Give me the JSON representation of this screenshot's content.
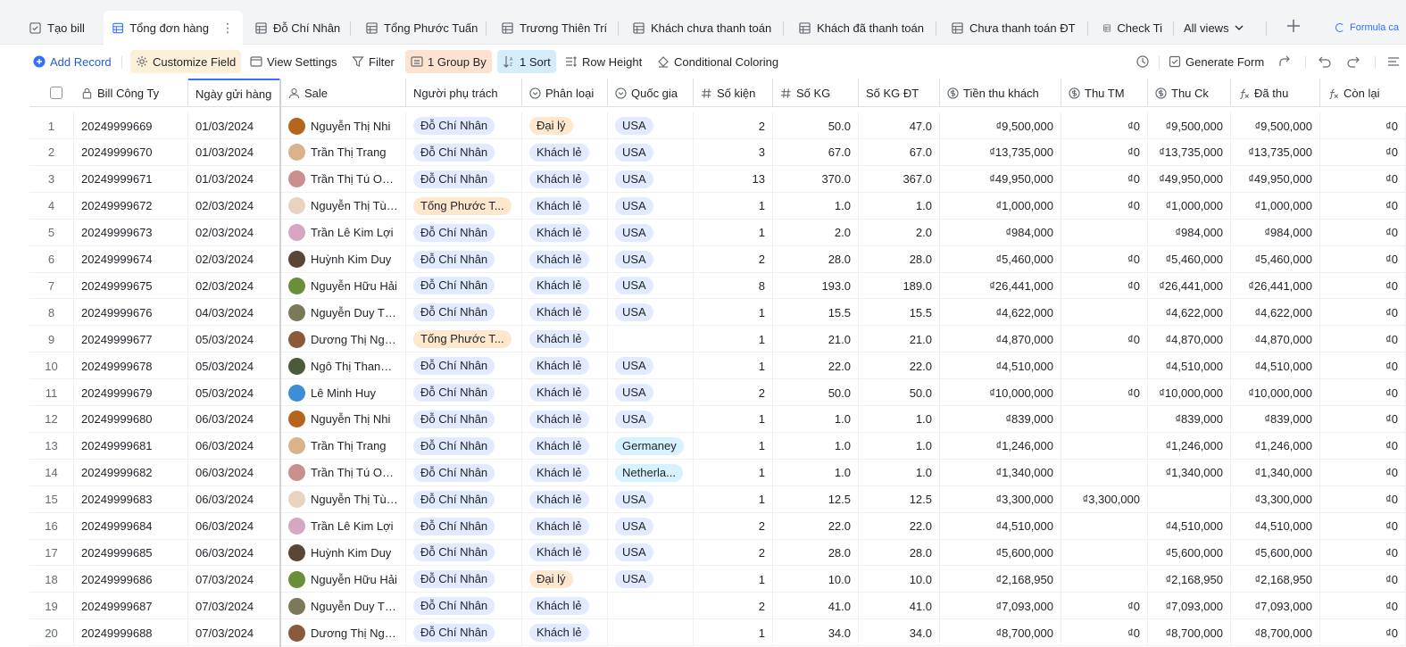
{
  "tabs": [
    {
      "label": "Tạo bill",
      "icon": "form-icon"
    },
    {
      "label": "Tổng đơn hàng",
      "icon": "grid-icon",
      "active": true
    },
    {
      "label": "Đỗ Chí Nhân",
      "icon": "grid-icon"
    },
    {
      "label": "Tổng Phước Tuấn",
      "icon": "grid-icon"
    },
    {
      "label": "Trương Thiên Trí",
      "icon": "grid-icon"
    },
    {
      "label": "Khách chưa thanh toán",
      "icon": "grid-icon"
    },
    {
      "label": "Khách đã thanh toán",
      "icon": "grid-icon"
    },
    {
      "label": "Chưa thanh toán ĐT",
      "icon": "grid-icon"
    },
    {
      "label": "Check Ti",
      "icon": "grid-icon"
    }
  ],
  "all_views": "All views",
  "formula_tab": "Formula ca",
  "toolbar": {
    "add_record": "Add Record",
    "customize_field": "Customize Field",
    "view_settings": "View Settings",
    "filter": "Filter",
    "group_by": "1 Group By",
    "sort": "1 Sort",
    "row_height": "Row Height",
    "conditional_coloring": "Conditional Coloring",
    "generate_form": "Generate Form"
  },
  "columns": [
    {
      "key": "bill",
      "label": "Bill Công Ty",
      "icon": "lock-icon"
    },
    {
      "key": "date",
      "label": "Ngày gửi hàng",
      "icon": ""
    },
    {
      "key": "sale",
      "label": "Sale",
      "icon": "person-icon"
    },
    {
      "key": "owner",
      "label": "Người phụ trách",
      "icon": ""
    },
    {
      "key": "type",
      "label": "Phân loại",
      "icon": "select-icon"
    },
    {
      "key": "country",
      "label": "Quốc gia",
      "icon": "select-icon"
    },
    {
      "key": "pkgs",
      "label": "Số kiện",
      "icon": "number-icon"
    },
    {
      "key": "kg",
      "label": "Số KG",
      "icon": "number-icon"
    },
    {
      "key": "kgdt",
      "label": "Số KG ĐT",
      "icon": ""
    },
    {
      "key": "collect",
      "label": "Tiền thu khách",
      "icon": "currency-icon"
    },
    {
      "key": "cash",
      "label": "Thu TM",
      "icon": "currency-icon"
    },
    {
      "key": "transfer",
      "label": "Thu Ck",
      "icon": "currency-icon"
    },
    {
      "key": "paid",
      "label": "Đã thu",
      "icon": "formula-icon"
    },
    {
      "key": "remain",
      "label": "Còn lại",
      "icon": "formula-icon"
    }
  ],
  "rows": [
    {
      "n": "1",
      "bill": "20249999669",
      "date": "01/03/2024",
      "sale": "Nguyễn Thị  Nhi",
      "owner": "Đỗ Chí Nhân",
      "type": "Đại lý",
      "country": "USA",
      "pkgs": "2",
      "kg": "50.0",
      "kgdt": "47.0",
      "collect": "₫9,500,000",
      "cash": "₫0",
      "transfer": "₫9,500,000",
      "paid": "₫9,500,000",
      "remain": "₫0",
      "avatar": "#b5651d"
    },
    {
      "n": "2",
      "bill": "20249999670",
      "date": "01/03/2024",
      "sale": "Trần Thị Trang",
      "owner": "Đỗ Chí Nhân",
      "type": "Khách lẻ",
      "country": "USA",
      "pkgs": "3",
      "kg": "67.0",
      "kgdt": "67.0",
      "collect": "₫13,735,000",
      "cash": "₫0",
      "transfer": "₫13,735,000",
      "paid": "₫13,735,000",
      "remain": "₫0",
      "avatar": "#d9b38c"
    },
    {
      "n": "3",
      "bill": "20249999671",
      "date": "01/03/2024",
      "sale": "Trần Thị Tú Oanh",
      "owner": "Đỗ Chí Nhân",
      "type": "Khách lẻ",
      "country": "USA",
      "pkgs": "13",
      "kg": "370.0",
      "kgdt": "367.0",
      "collect": "₫49,950,000",
      "cash": "₫0",
      "transfer": "₫49,950,000",
      "paid": "₫49,950,000",
      "remain": "₫0",
      "avatar": "#c98f8f"
    },
    {
      "n": "4",
      "bill": "20249999672",
      "date": "02/03/2024",
      "sale": "Nguyễn Thị Tùn...",
      "owner": "Tống Phước T...",
      "type": "Khách lẻ",
      "country": "USA",
      "pkgs": "1",
      "kg": "1.0",
      "kgdt": "1.0",
      "collect": "₫1,000,000",
      "cash": "₫0",
      "transfer": "₫1,000,000",
      "paid": "₫1,000,000",
      "remain": "₫0",
      "avatar": "#e8d3c0"
    },
    {
      "n": "5",
      "bill": "20249999673",
      "date": "02/03/2024",
      "sale": "Trần Lê Kim Lợi",
      "owner": "Đỗ Chí Nhân",
      "type": "Khách lẻ",
      "country": "USA",
      "pkgs": "1",
      "kg": "2.0",
      "kgdt": "2.0",
      "collect": "₫984,000",
      "cash": "",
      "transfer": "₫984,000",
      "paid": "₫984,000",
      "remain": "₫0",
      "avatar": "#d7a6c2"
    },
    {
      "n": "6",
      "bill": "20249999674",
      "date": "02/03/2024",
      "sale": "Huỳnh Kim Duy",
      "owner": "Đỗ Chí Nhân",
      "type": "Khách lẻ",
      "country": "USA",
      "pkgs": "2",
      "kg": "28.0",
      "kgdt": "28.0",
      "collect": "₫5,460,000",
      "cash": "₫0",
      "transfer": "₫5,460,000",
      "paid": "₫5,460,000",
      "remain": "₫0",
      "avatar": "#5a4636"
    },
    {
      "n": "7",
      "bill": "20249999675",
      "date": "02/03/2024",
      "sale": "Nguyễn Hữu Hải",
      "owner": "Đỗ Chí Nhân",
      "type": "Khách lẻ",
      "country": "USA",
      "pkgs": "8",
      "kg": "193.0",
      "kgdt": "189.0",
      "collect": "₫26,441,000",
      "cash": "₫0",
      "transfer": "₫26,441,000",
      "paid": "₫26,441,000",
      "remain": "₫0",
      "avatar": "#6b8e3a"
    },
    {
      "n": "8",
      "bill": "20249999676",
      "date": "04/03/2024",
      "sale": "Nguyễn Duy Th...",
      "owner": "Đỗ Chí Nhân",
      "type": "Khách lẻ",
      "country": "USA",
      "pkgs": "1",
      "kg": "15.5",
      "kgdt": "15.5",
      "collect": "₫4,622,000",
      "cash": "",
      "transfer": "₫4,622,000",
      "paid": "₫4,622,000",
      "remain": "₫0",
      "avatar": "#7a7a5a"
    },
    {
      "n": "9",
      "bill": "20249999677",
      "date": "05/03/2024",
      "sale": "Dương Thị Ngọ...",
      "owner": "Tống Phước T...",
      "type": "Khách lẻ",
      "country": "",
      "pkgs": "1",
      "kg": "21.0",
      "kgdt": "21.0",
      "collect": "₫4,870,000",
      "cash": "₫0",
      "transfer": "₫4,870,000",
      "paid": "₫4,870,000",
      "remain": "₫0",
      "avatar": "#8b5a3c"
    },
    {
      "n": "10",
      "bill": "20249999678",
      "date": "05/03/2024",
      "sale": "Ngô Thị Thanh ...",
      "owner": "Đỗ Chí Nhân",
      "type": "Khách lẻ",
      "country": "USA",
      "pkgs": "1",
      "kg": "22.0",
      "kgdt": "22.0",
      "collect": "₫4,510,000",
      "cash": "",
      "transfer": "₫4,510,000",
      "paid": "₫4,510,000",
      "remain": "₫0",
      "avatar": "#4a5a3a"
    },
    {
      "n": "11",
      "bill": "20249999679",
      "date": "05/03/2024",
      "sale": "Lê Minh Huy",
      "owner": "Đỗ Chí Nhân",
      "type": "Khách lẻ",
      "country": "USA",
      "pkgs": "2",
      "kg": "50.0",
      "kgdt": "50.0",
      "collect": "₫10,000,000",
      "cash": "₫0",
      "transfer": "₫10,000,000",
      "paid": "₫10,000,000",
      "remain": "₫0",
      "avatar": "#3a8fd6"
    },
    {
      "n": "12",
      "bill": "20249999680",
      "date": "06/03/2024",
      "sale": "Nguyễn Thị  Nhi",
      "owner": "Đỗ Chí Nhân",
      "type": "Khách lẻ",
      "country": "USA",
      "pkgs": "1",
      "kg": "1.0",
      "kgdt": "1.0",
      "collect": "₫839,000",
      "cash": "",
      "transfer": "₫839,000",
      "paid": "₫839,000",
      "remain": "₫0",
      "avatar": "#b5651d"
    },
    {
      "n": "13",
      "bill": "20249999681",
      "date": "06/03/2024",
      "sale": "Trần Thị Trang",
      "owner": "Đỗ Chí Nhân",
      "type": "Khách lẻ",
      "country": "Germaney",
      "pkgs": "1",
      "kg": "1.0",
      "kgdt": "1.0",
      "collect": "₫1,246,000",
      "cash": "",
      "transfer": "₫1,246,000",
      "paid": "₫1,246,000",
      "remain": "₫0",
      "avatar": "#d9b38c"
    },
    {
      "n": "14",
      "bill": "20249999682",
      "date": "06/03/2024",
      "sale": "Trần Thị Tú Oanh",
      "owner": "Đỗ Chí Nhân",
      "type": "Khách lẻ",
      "country": "Netherla...",
      "pkgs": "1",
      "kg": "1.0",
      "kgdt": "1.0",
      "collect": "₫1,340,000",
      "cash": "",
      "transfer": "₫1,340,000",
      "paid": "₫1,340,000",
      "remain": "₫0",
      "avatar": "#c98f8f"
    },
    {
      "n": "15",
      "bill": "20249999683",
      "date": "06/03/2024",
      "sale": "Nguyễn Thị Tùn...",
      "owner": "Đỗ Chí Nhân",
      "type": "Khách lẻ",
      "country": "USA",
      "pkgs": "1",
      "kg": "12.5",
      "kgdt": "12.5",
      "collect": "₫3,300,000",
      "cash": "₫3,300,000",
      "transfer": "",
      "paid": "₫3,300,000",
      "remain": "₫0",
      "avatar": "#e8d3c0"
    },
    {
      "n": "16",
      "bill": "20249999684",
      "date": "06/03/2024",
      "sale": "Trần Lê Kim Lợi",
      "owner": "Đỗ Chí Nhân",
      "type": "Khách lẻ",
      "country": "USA",
      "pkgs": "2",
      "kg": "22.0",
      "kgdt": "22.0",
      "collect": "₫4,510,000",
      "cash": "",
      "transfer": "₫4,510,000",
      "paid": "₫4,510,000",
      "remain": "₫0",
      "avatar": "#d7a6c2"
    },
    {
      "n": "17",
      "bill": "20249999685",
      "date": "06/03/2024",
      "sale": "Huỳnh Kim Duy",
      "owner": "Đỗ Chí Nhân",
      "type": "Khách lẻ",
      "country": "USA",
      "pkgs": "2",
      "kg": "28.0",
      "kgdt": "28.0",
      "collect": "₫5,600,000",
      "cash": "",
      "transfer": "₫5,600,000",
      "paid": "₫5,600,000",
      "remain": "₫0",
      "avatar": "#5a4636"
    },
    {
      "n": "18",
      "bill": "20249999686",
      "date": "07/03/2024",
      "sale": "Nguyễn Hữu Hải",
      "owner": "Đỗ Chí Nhân",
      "type": "Đại lý",
      "country": "USA",
      "pkgs": "1",
      "kg": "10.0",
      "kgdt": "10.0",
      "collect": "₫2,168,950",
      "cash": "",
      "transfer": "₫2,168,950",
      "paid": "₫2,168,950",
      "remain": "₫0",
      "avatar": "#6b8e3a"
    },
    {
      "n": "19",
      "bill": "20249999687",
      "date": "07/03/2024",
      "sale": "Nguyễn Duy Th...",
      "owner": "Đỗ Chí Nhân",
      "type": "Khách lẻ",
      "country": "",
      "pkgs": "2",
      "kg": "41.0",
      "kgdt": "41.0",
      "collect": "₫7,093,000",
      "cash": "₫0",
      "transfer": "₫7,093,000",
      "paid": "₫7,093,000",
      "remain": "₫0",
      "avatar": "#7a7a5a"
    },
    {
      "n": "20",
      "bill": "20249999688",
      "date": "07/03/2024",
      "sale": "Dương Thị Ngọ...",
      "owner": "Đỗ Chí Nhân",
      "type": "Khách lẻ",
      "country": "",
      "pkgs": "1",
      "kg": "34.0",
      "kgdt": "34.0",
      "collect": "₫8,700,000",
      "cash": "₫0",
      "transfer": "₫8,700,000",
      "paid": "₫8,700,000",
      "remain": "₫0",
      "avatar": "#8b5a3c"
    }
  ]
}
